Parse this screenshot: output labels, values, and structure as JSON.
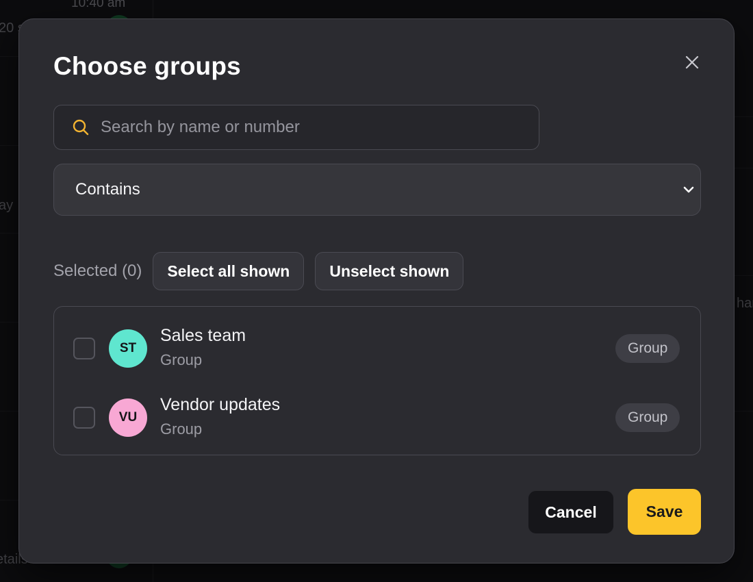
{
  "background": {
    "time_fragment": "10:40 am",
    "left_fragments": [
      "20 s",
      "ay",
      "etails"
    ],
    "right_fragment": "har"
  },
  "modal": {
    "title": "Choose groups",
    "search": {
      "placeholder": "Search by name or number",
      "value": ""
    },
    "filter": {
      "selected": "Contains"
    },
    "selection": {
      "count_label": "Selected (0)",
      "select_all_label": "Select all shown",
      "unselect_label": "Unselect shown"
    },
    "items": [
      {
        "initials": "ST",
        "name": "Sales team",
        "subtitle": "Group",
        "badge": "Group",
        "avatar_color": "#5fe6cf",
        "checked": false
      },
      {
        "initials": "VU",
        "name": "Vendor updates",
        "subtitle": "Group",
        "badge": "Group",
        "avatar_color": "#f8a8d4",
        "checked": false
      }
    ],
    "footer": {
      "cancel_label": "Cancel",
      "save_label": "Save"
    }
  },
  "colors": {
    "accent": "#fcc52a",
    "modal_bg": "#2b2b30",
    "search_icon": "#f3b431"
  },
  "icons": {
    "close": "close-icon",
    "search": "search-icon",
    "dropdown": "chevron-down-icon"
  }
}
